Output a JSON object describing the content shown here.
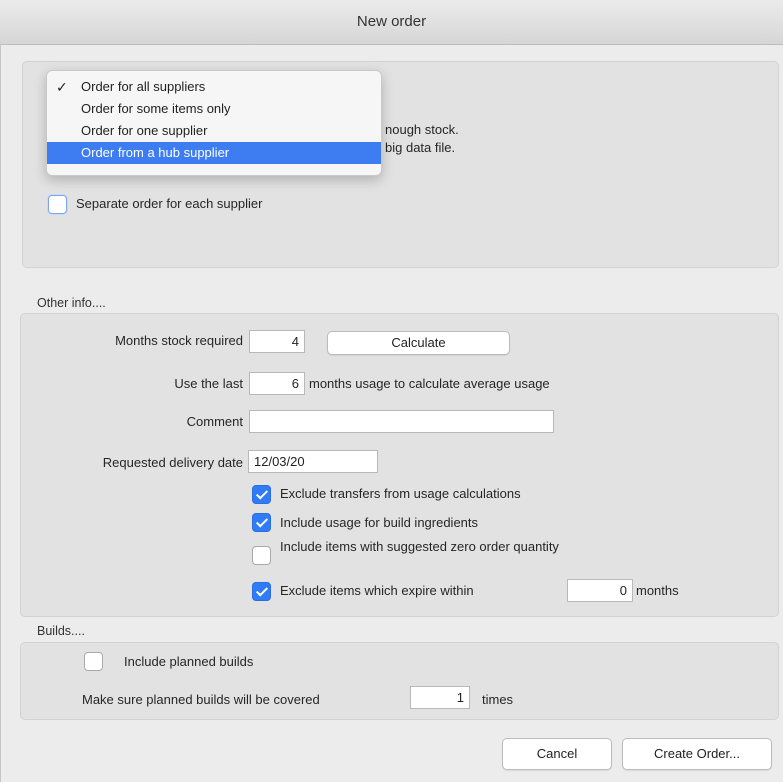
{
  "window": {
    "title": "New order"
  },
  "dropdown": {
    "checkmark": "✓",
    "items": [
      {
        "label": "Order for all suppliers",
        "checked": true
      },
      {
        "label": "Order for some items only"
      },
      {
        "label": "Order for one supplier"
      },
      {
        "label": "Order from a hub supplier",
        "highlighted": true
      }
    ]
  },
  "order_type": {
    "partial_text_1": "nough stock.",
    "partial_text_2": "big data file.",
    "separate_order_label": "Separate order for each supplier"
  },
  "other_info": {
    "section_label": "Other info....",
    "months_stock_label": "Months stock required",
    "months_stock_value": "4",
    "calculate_label": "Calculate",
    "use_last_label": "Use the last",
    "use_last_value": "6",
    "use_last_suffix": "months usage to calculate average usage",
    "comment_label": "Comment",
    "comment_value": "",
    "delivery_date_label": "Requested delivery date",
    "delivery_date_value": "12/03/20",
    "exclude_transfers_label": "Exclude transfers from usage calculations",
    "include_build_label": "Include usage for build ingredients",
    "include_zero_label": "Include items with suggested zero order quantity",
    "exclude_expire_label": "Exclude items which expire within",
    "exclude_expire_value": "0",
    "exclude_expire_unit": "months"
  },
  "builds": {
    "section_label": "Builds....",
    "include_planned_label": "Include planned builds",
    "covered_label": "Make sure planned builds will be covered",
    "covered_value": "1",
    "covered_suffix": "times"
  },
  "footer": {
    "cancel_label": "Cancel",
    "create_label": "Create Order..."
  },
  "colors": {
    "accent": "#2f7cf6",
    "menu_highlight": "#3e7cf2",
    "panel": "#e2e2e2"
  }
}
